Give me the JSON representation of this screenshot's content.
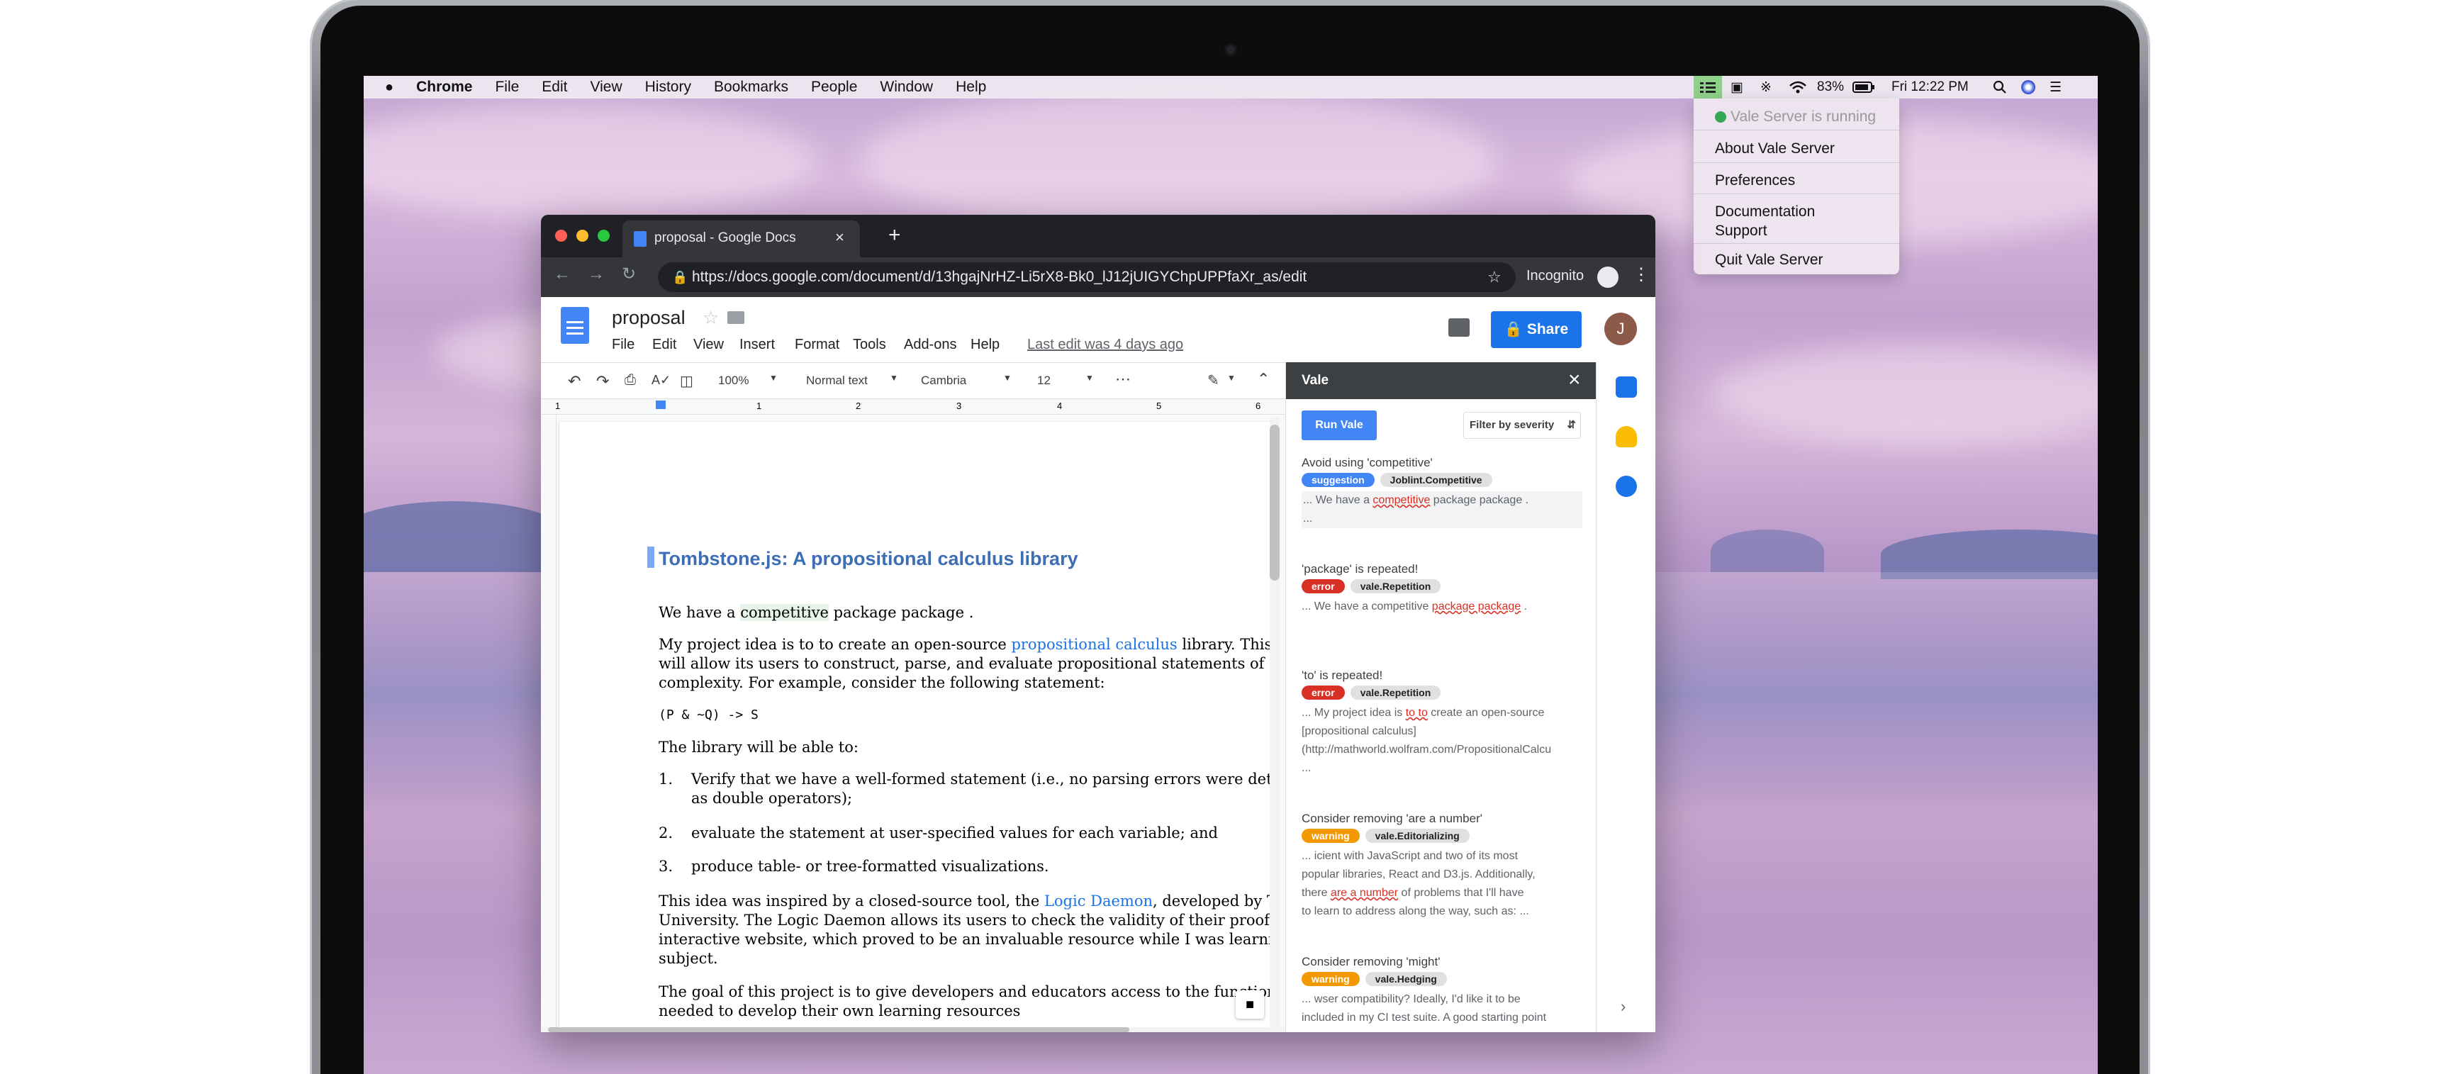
{
  "menubar": {
    "app": "Chrome",
    "items": [
      "File",
      "Edit",
      "View",
      "History",
      "Bookmarks",
      "People",
      "Window",
      "Help"
    ],
    "battery": "83%",
    "clock": "Fri 12:22 PM"
  },
  "vale_menu": {
    "status": "Vale Server is running",
    "items": [
      "About Vale Server",
      "Preferences",
      "Documentation",
      "Support",
      "Quit Vale Server"
    ],
    "status_color": "#34a853"
  },
  "browser": {
    "tab_title": "proposal - Google Docs",
    "url": "https://docs.google.com/document/d/13hgajNrHZ-Li5rX8-Bk0_lJ12jUIGYChpUPPfaXr_as/edit",
    "incognito": "Incognito"
  },
  "docs": {
    "title": "proposal",
    "menus": [
      "File",
      "Edit",
      "View",
      "Insert",
      "Format",
      "Tools",
      "Add-ons",
      "Help"
    ],
    "last_edit": "Last edit was 4 days ago",
    "share": "Share",
    "avatar": "J",
    "toolbar": {
      "zoom": "100%",
      "style": "Normal text",
      "font": "Cambria",
      "size": "12"
    },
    "ruler": [
      "1",
      "1",
      "2",
      "3",
      "4",
      "5",
      "6"
    ],
    "heading": "Tombstone.js: A propositional calculus library",
    "para1": {
      "a": "We have a ",
      "b": "competitive",
      "c": " package package ."
    },
    "para2": {
      "a": "My project idea is to to create an open-source ",
      "link": "propositional calculus",
      "b": " library. This librar"
    },
    "para2b": "will allow its users to construct, parse, and evaluate propositional statements of arbitra",
    "para2c": "complexity. For example, consider the following statement:",
    "code": "(P & ~Q) -> S",
    "para3": "The library will be able to:",
    "list": [
      {
        "n": "1.",
        "t": "Verify that we have a well-formed statement (i.e., no parsing errors were detected",
        "t2": "as double operators);"
      },
      {
        "n": "2.",
        "t": "evaluate the statement at user-specified values for each variable; and"
      },
      {
        "n": "3.",
        "t": "produce table- or tree-formatted visualizations."
      }
    ],
    "para4": {
      "a": "This idea was inspired by a closed-source tool, the ",
      "link": "Logic Daemon",
      "b": ", developed by Texas A"
    },
    "para4b": "University. The Logic Daemon allows its users to check the validity of their proofs via an",
    "para4c": "interactive website, which proved to be an invaluable resource while I was learning the",
    "para4d": "subject.",
    "para5": "The goal of this project is to give developers and educators access to the functiona",
    "para5b": "needed to develop their own learning resources"
  },
  "vale": {
    "title": "Vale",
    "run": "Run Vale",
    "filter": "Filter by severity",
    "alerts": [
      {
        "msg": "Avoid using 'competitive'",
        "sev": "suggestion",
        "sev_color": "#4285f4",
        "rule": "Joblint.Competitive",
        "pre": "... We have a ",
        "hit": "competitive",
        "post": " package package .",
        "more": "..."
      },
      {
        "msg": "'package' is repeated!",
        "sev": "error",
        "sev_color": "#d93025",
        "rule": "vale.Repetition",
        "pre": "... We have a competitive ",
        "hit": "package package",
        "post": " ."
      },
      {
        "msg": "'to' is repeated!",
        "sev": "error",
        "sev_color": "#d93025",
        "rule": "vale.Repetition",
        "pre": "... My project idea is ",
        "hit": "to to",
        "post": " create an open-source",
        "l2": "[propositional calculus]",
        "l3": "(http://mathworld.wolfram.com/PropositionalCalcu",
        "l4": "..."
      },
      {
        "msg": "Consider removing 'are a number'",
        "sev": "warning",
        "sev_color": "#f29900",
        "rule": "vale.Editorializing",
        "l1": "... icient with JavaScript and two of its most",
        "l2": "popular libraries, React and D3.js. Additionally,",
        "pre": "there ",
        "hit": "are a number",
        "post": " of problems that I'll have",
        "l4": "to learn to address along the way, such as: ..."
      },
      {
        "msg": "Consider removing 'might'",
        "sev": "warning",
        "sev_color": "#f29900",
        "rule": "vale.Hedging",
        "l1": "... wser compatibility? Ideally, I'd like it to be",
        "l2": "included in my CI test suite. A good starting point"
      }
    ]
  }
}
